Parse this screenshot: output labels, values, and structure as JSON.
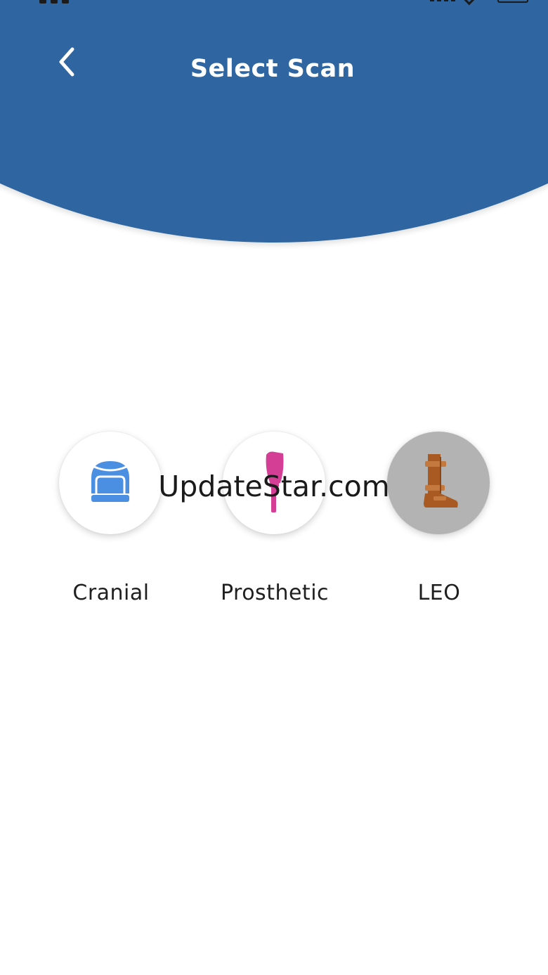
{
  "header": {
    "title": "Select Scan",
    "color": "#2f65a0"
  },
  "scan_options": [
    {
      "label": "Cranial",
      "icon": "helmet-icon",
      "icon_color": "#4a8fe2",
      "selected": false
    },
    {
      "label": "Prosthetic",
      "icon": "prosthetic-leg-icon",
      "icon_color": "#d43f95",
      "selected": false
    },
    {
      "label": "LEO",
      "icon": "leg-brace-boot-icon",
      "icon_color": "#a85a22",
      "selected": true
    }
  ],
  "watermark": "UpdateStar.com"
}
